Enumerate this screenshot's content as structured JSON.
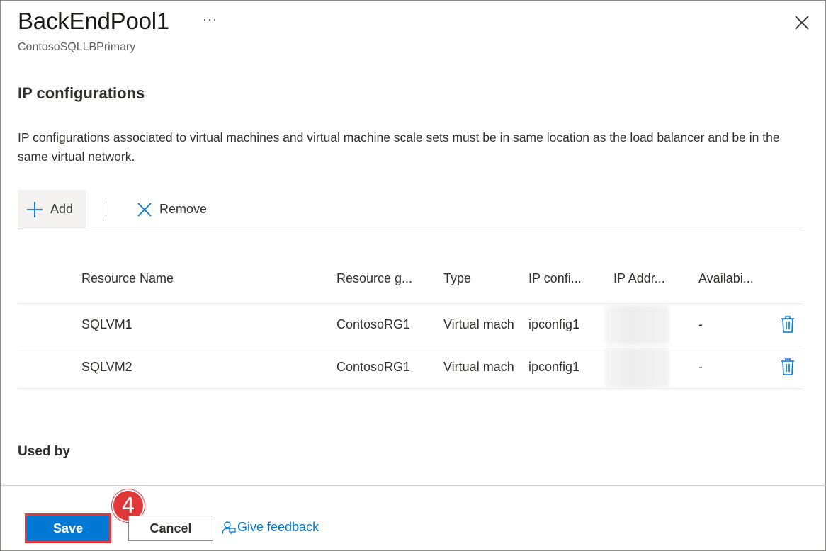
{
  "header": {
    "title": "BackEndPool1",
    "more_label": "···",
    "subtitle": "ContosoSQLLBPrimary"
  },
  "section": {
    "title": "IP configurations",
    "description": "IP configurations associated to virtual machines and virtual machine scale sets must be in same location as the load balancer and be in the same virtual network."
  },
  "toolbar": {
    "add_label": "Add",
    "remove_label": "Remove"
  },
  "table": {
    "columns": [
      "Resource Name",
      "Resource g...",
      "Type",
      "IP confi...",
      "IP Addr...",
      "Availabi..."
    ],
    "rows": [
      {
        "resource_name": "SQLVM1",
        "resource_group": "ContosoRG1",
        "type": "Virtual mach",
        "ip_config": "ipconfig1",
        "ip_address": "",
        "availability": "-"
      },
      {
        "resource_name": "SQLVM2",
        "resource_group": "ContosoRG1",
        "type": "Virtual mach",
        "ip_config": "ipconfig1",
        "ip_address": "",
        "availability": "-"
      }
    ]
  },
  "used_by": {
    "title": "Used by"
  },
  "footer": {
    "save_label": "Save",
    "cancel_label": "Cancel",
    "feedback_label": "Give feedback",
    "step_badge": "4"
  },
  "colors": {
    "accent": "#0078d4",
    "highlight": "#e03838",
    "text": "#323130"
  }
}
